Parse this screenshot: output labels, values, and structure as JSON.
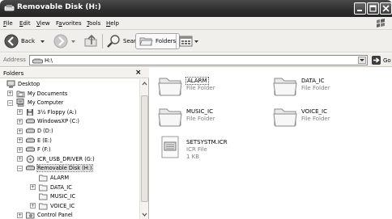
{
  "window": {
    "title": "Removable Disk (H:)"
  },
  "menu": [
    {
      "label": "File",
      "ul": "F",
      "rest": "ile"
    },
    {
      "label": "Edit",
      "ul": "E",
      "rest": "dit"
    },
    {
      "label": "View",
      "ul": "V",
      "rest": "iew"
    },
    {
      "label": "Favorites",
      "ul": "",
      "pre": "F",
      "mid": "a",
      "rest": "vorites"
    },
    {
      "label": "Tools",
      "ul": "T",
      "rest": "ools"
    },
    {
      "label": "Help",
      "ul": "H",
      "rest": "elp"
    }
  ],
  "toolbar": {
    "back_label": "Back",
    "search_label": "Search",
    "folders_label": "Folders"
  },
  "address": {
    "label": "Address",
    "value": "H:\\",
    "go_label": "Go"
  },
  "folders_pane": {
    "title": "Folders",
    "close_glyph": "×",
    "tree": [
      {
        "label": "Desktop",
        "icon": "desktop-icon",
        "level": 0,
        "expander": ""
      },
      {
        "label": "My Documents",
        "icon": "my-documents-icon",
        "level": 1,
        "expander": "+"
      },
      {
        "label": "My Computer",
        "icon": "my-computer-icon",
        "level": 1,
        "expander": "−"
      },
      {
        "label": "3½ Floppy (A:)",
        "icon": "floppy-drive-icon",
        "level": 2,
        "expander": "+"
      },
      {
        "label": "WindowsXP (C:)",
        "icon": "hard-drive-icon",
        "level": 2,
        "expander": "+"
      },
      {
        "label": "D (D:)",
        "icon": "hard-drive-icon",
        "level": 2,
        "expander": "+"
      },
      {
        "label": "E (E:)",
        "icon": "hard-drive-icon",
        "level": 2,
        "expander": "+"
      },
      {
        "label": "F (F:)",
        "icon": "hard-drive-icon",
        "level": 2,
        "expander": "+"
      },
      {
        "label": "ICR_USB_DRIVER (G:)",
        "icon": "cd-drive-icon",
        "level": 2,
        "expander": "+"
      },
      {
        "label": "Removable Disk (H:)",
        "icon": "removable-disk-icon",
        "level": 2,
        "expander": "−",
        "selected": true
      },
      {
        "label": "ALARM",
        "icon": "folder-icon",
        "level": 3,
        "expander": ""
      },
      {
        "label": "DATA_IC",
        "icon": "folder-icon",
        "level": 3,
        "expander": "+"
      },
      {
        "label": "MUSIC_IC",
        "icon": "folder-icon",
        "level": 3,
        "expander": ""
      },
      {
        "label": "VOICE_IC",
        "icon": "folder-icon",
        "level": 3,
        "expander": "+"
      },
      {
        "label": "Control Panel",
        "icon": "control-panel-icon",
        "level": 2,
        "expander": "+"
      }
    ]
  },
  "content": {
    "items": [
      {
        "name": "ALARM",
        "type": "File Folder",
        "icon": "folder-icon",
        "focused": true
      },
      {
        "name": "DATA_IC",
        "type": "File Folder",
        "icon": "folder-icon"
      },
      {
        "name": "MUSIC_IC",
        "type": "File Folder",
        "icon": "folder-icon"
      },
      {
        "name": "VOICE_IC",
        "type": "File Folder",
        "icon": "folder-icon"
      },
      {
        "name": "SETSYSTM.ICR",
        "type": "ICR File",
        "size": "1 KB",
        "icon": "icr-file-icon"
      }
    ]
  }
}
